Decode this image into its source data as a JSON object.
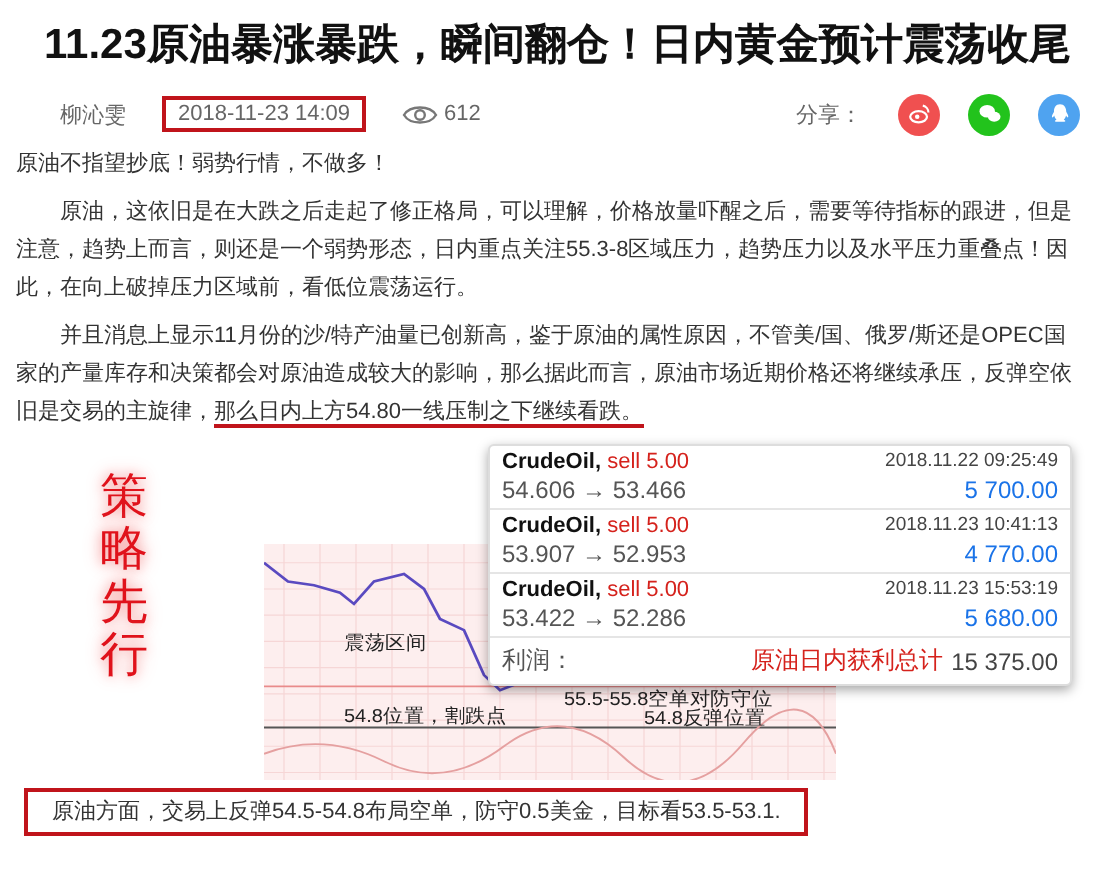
{
  "title": "11.23原油暴涨暴跌，瞬间翻仓！日内黄金预计震荡收尾",
  "meta": {
    "author": "柳沁雯",
    "date": "2018-11-23 14:09",
    "views": "612",
    "share_label": "分享："
  },
  "share": [
    {
      "kind": "weibo",
      "color": "#f05050"
    },
    {
      "kind": "wechat",
      "color": "#22c31c"
    },
    {
      "kind": "qq",
      "color": "#4fa3f0"
    }
  ],
  "paragraphs": [
    {
      "text": "原油不指望抄底！弱势行情，不做多！",
      "indent": false
    },
    {
      "text": "原油，这依旧是在大跌之后走起了修正格局，可以理解，价格放量吓醒之后，需要等待指标的跟进，但是注意，趋势上而言，则还是一个弱势形态，日内重点关注55.3-8区域压力，趋势压力以及水平压力重叠点！因此，在向上破掉压力区域前，看低位震荡运行。",
      "indent": true
    },
    {
      "text": "并且消息上显示11月份的沙/特产油量已创新高，鉴于原油的属性原因，不管美/国、俄罗/斯还是OPEC国家的产量库存和决策都会对原油造成较大的影响，那么据此而言，原油市场近期价格还将继续承压，反弹空依旧是交易的主旋律，",
      "underlined": "那么日内上方54.80一线压制之下继续看跌。",
      "indent": true
    }
  ],
  "slogan": "策略先行",
  "chart": {
    "labels": [
      "震荡区间",
      "55.5-55.8空单对防守位",
      "54.8位置，割跌点",
      "54.8反弹位置"
    ]
  },
  "trades": [
    {
      "symbol": "CrudeOil,",
      "action": "sell 5.00",
      "time": "2018.11.22 09:25:49",
      "prices": "54.606 → 53.466",
      "profit": "5 700.00"
    },
    {
      "symbol": "CrudeOil,",
      "action": "sell 5.00",
      "time": "2018.11.23 10:41:13",
      "prices": "53.907 → 52.953",
      "profit": "4 770.00"
    },
    {
      "symbol": "CrudeOil,",
      "action": "sell 5.00",
      "time": "2018.11.23 15:53:19",
      "prices": "53.422 → 52.286",
      "profit": "5 680.00"
    }
  ],
  "trade_total": {
    "label": "利润：",
    "note": "原油日内获利总计",
    "value": "15 375.00"
  },
  "conclusion": "原油方面，交易上反弹54.5-54.8布局空单，防守0.5美金，目标看53.5-53.1."
}
